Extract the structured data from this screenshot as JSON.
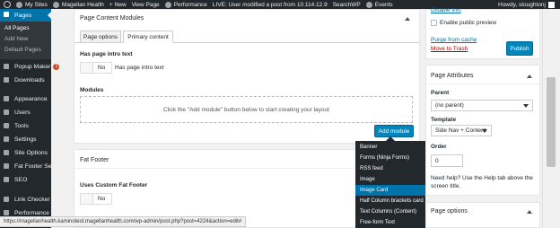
{
  "adminbar": {
    "my_sites": "My Sites",
    "site_name": "Magellan Health",
    "new": "New",
    "view_page": "View Page",
    "performance": "Performance",
    "live_status": "LIVE: User modified a post from 10.114.12.9",
    "searchwp": "SearchWP",
    "events": "Events",
    "user": "Howdy, stoughtonj"
  },
  "sidebar": {
    "current": "Pages",
    "sub": [
      "All Pages",
      "Add New",
      "Default Pages"
    ],
    "items": [
      {
        "label": "Popup Maker",
        "badge": "1"
      },
      {
        "label": "Downloads"
      },
      {
        "label": "Appearance"
      },
      {
        "label": "Users"
      },
      {
        "label": "Tools"
      },
      {
        "label": "Settings"
      },
      {
        "label": "Site Options"
      },
      {
        "label": "Fat Footer Sets"
      },
      {
        "label": "SEO"
      },
      {
        "label": "Link Checker"
      },
      {
        "label": "Performance"
      }
    ]
  },
  "content_modules": {
    "title": "Page Content Modules",
    "tabs": [
      "Page options",
      "Primary content"
    ],
    "intro_label": "Has page intro text",
    "intro_toggle": "No",
    "intro_hint": "Has page intro text",
    "modules_label": "Modules",
    "dropzone_text": "Click the \"Add module\" button below to start creating your layout",
    "add_module": "Add module"
  },
  "fat_footer": {
    "title": "Fat Footer",
    "label": "Uses Custom Fat Footer",
    "toggle": "No"
  },
  "module_menu": {
    "items": [
      "Banner",
      "Forms (Ninja Forms)",
      "RSS feed",
      "Image",
      "Image Card",
      "Half Column brackets card",
      "Text Columns (Content)",
      "Free-form Text"
    ],
    "highlighted": "Image Card"
  },
  "publish": {
    "disable_link": "Disable this",
    "enable_preview": "Enable public preview",
    "purge": "Purge from cache",
    "trash": "Move to Trash",
    "publish_button": "Publish"
  },
  "page_attributes": {
    "title": "Page Attributes",
    "parent_label": "Parent",
    "parent_value": "(no parent)",
    "template_label": "Template",
    "template_value": "Side Nav + Content",
    "order_label": "Order",
    "order_value": "0",
    "help_text_1": "Need help? Use the Help tab above the",
    "help_text_2": "screen title."
  },
  "page_options": {
    "title": "Page options"
  },
  "statusbar": {
    "url": "https://magellanhealth.kaminotest.magellanhealth.com/wp-admin/post.php?post=4224&action=edit#"
  }
}
